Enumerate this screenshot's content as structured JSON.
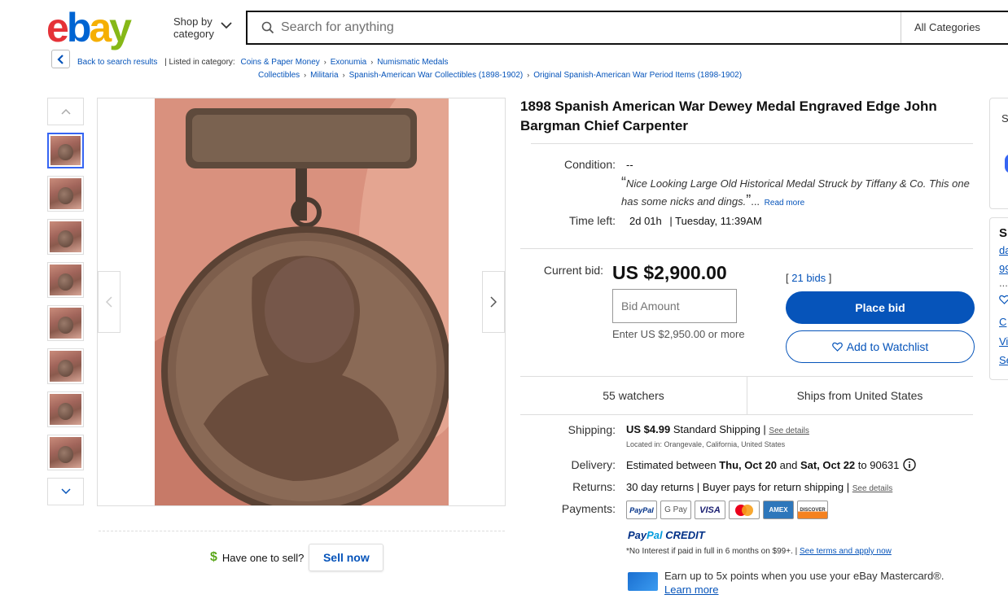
{
  "header": {
    "logo": {
      "e": "e",
      "b": "b",
      "a": "a",
      "y": "y"
    },
    "shop_by_line1": "Shop by",
    "shop_by_line2": "category",
    "search_placeholder": "Search for anything",
    "category_select": "All Categories"
  },
  "breadcrumb": {
    "back": "Back to search results",
    "listed_in": "| Listed in category:",
    "items_row1": [
      "Coins & Paper Money",
      "Exonumia",
      "Numismatic Medals"
    ],
    "items_row2": [
      "Collectibles",
      "Militaria",
      "Spanish-American War Collectibles (1898-1902)",
      "Original Spanish-American War Period Items (1898-1902)"
    ]
  },
  "listing": {
    "title": "1898 Spanish American War Dewey Medal Engraved Edge John Bargman Chief Carpenter",
    "condition_label": "Condition:",
    "condition_value": "--",
    "quote_open": "“",
    "quote_text": "Nice Looking Large Old Historical Medal Struck by Tiffany & Co. This one has some nicks and dings.",
    "quote_close": "”",
    "ellipsis": "...",
    "read_more": "Read more",
    "time_left_label": "Time left:",
    "time_left_value": "2d 01h",
    "time_left_end": "| Tuesday, 11:39AM",
    "current_bid_label": "Current bid:",
    "current_bid": "US $2,900.00",
    "bids_open": "[",
    "bids_link": "21 bids",
    "bids_close": "]",
    "bid_placeholder": "Bid Amount",
    "enter_more": "Enter US $2,950.00 or more",
    "place_bid": "Place bid",
    "add_watchlist": "Add to Watchlist",
    "watchers": "55 watchers",
    "ships_from": "Ships from United States"
  },
  "shipping": {
    "label": "Shipping:",
    "price": "US $4.99",
    "method": "Standard Shipping |",
    "see_details": "See details",
    "located": "Located in: Orangevale, California, United States"
  },
  "delivery": {
    "label": "Delivery:",
    "pre": "Estimated between",
    "date1": "Thu, Oct 20",
    "and": "and",
    "date2": "Sat, Oct 22",
    "to": "to 90631"
  },
  "returns": {
    "label": "Returns:",
    "text": "30 day returns | Buyer pays for return shipping |",
    "see_details": "See details"
  },
  "payments": {
    "label": "Payments:",
    "cards": [
      "PayPal",
      "G Pay",
      "VISA",
      "",
      "AMEX",
      "DISCOVER"
    ]
  },
  "paypal_credit": {
    "pay": "Pay",
    "pal": "Pal",
    "credit": "CREDIT",
    "no_interest": "*No Interest if paid in full in 6 months on $99+. |",
    "terms_link": "See terms and apply now"
  },
  "mastercard": {
    "text": "Earn up to 5x points when you use your eBay Mastercard®.",
    "learn_more": "Learn more"
  },
  "sell": {
    "dollar": "$",
    "question": "Have one to sell?",
    "button": "Sell now"
  },
  "side": {
    "s1": "S",
    "s2": "S",
    "l1": "da",
    "l2": "99",
    "l3": "...",
    "l4": "C",
    "l5": "Vi",
    "l6": "Se"
  },
  "colors": {
    "accent": "#0654ba",
    "thumb_active": "#3665f3",
    "logo_e": "#e53238",
    "logo_b": "#0064d2",
    "logo_a": "#f5af02",
    "logo_y": "#86b817"
  }
}
